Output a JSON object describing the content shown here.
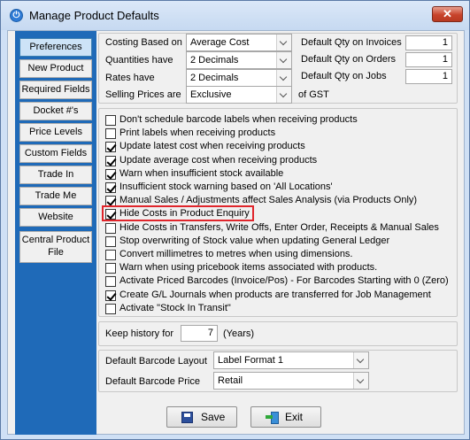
{
  "window": {
    "title": "Manage Product Defaults",
    "close_glyph": "✕"
  },
  "sidebar": {
    "items": [
      {
        "label": "Preferences"
      },
      {
        "label": "New Product"
      },
      {
        "label": "Required Fields"
      },
      {
        "label": "Docket #'s"
      },
      {
        "label": "Price Levels"
      },
      {
        "label": "Custom Fields"
      },
      {
        "label": "Trade In"
      },
      {
        "label": "Trade Me"
      },
      {
        "label": "Website"
      },
      {
        "label": "Central Product File"
      }
    ]
  },
  "settings": {
    "costing_label": "Costing Based on",
    "costing_value": "Average Cost",
    "quantities_label": "Quantities have",
    "quantities_value": "2 Decimals",
    "rates_label": "Rates have",
    "rates_value": "2 Decimals",
    "selling_label": "Selling Prices are",
    "selling_value": "Exclusive",
    "gst_suffix": "of GST",
    "qty_invoices_label": "Default Qty on Invoices",
    "qty_invoices_value": "1",
    "qty_orders_label": "Default Qty on Orders",
    "qty_orders_value": "1",
    "qty_jobs_label": "Default Qty on Jobs",
    "qty_jobs_value": "1"
  },
  "options": [
    {
      "label": "Don't schedule barcode labels when receiving products",
      "checked": false
    },
    {
      "label": "Print labels when receiving products",
      "checked": false
    },
    {
      "label": "Update latest cost when receiving products",
      "checked": true
    },
    {
      "label": "Update average cost when receiving products",
      "checked": true
    },
    {
      "label": "Warn when insufficient stock available",
      "checked": true
    },
    {
      "label": "Insufficient stock warning based on 'All Locations'",
      "checked": true
    },
    {
      "label": "Manual Sales / Adjustments affect Sales Analysis (via Products Only)",
      "checked": true
    },
    {
      "label": "Hide Costs in Product Enquiry",
      "checked": true
    },
    {
      "label": "Hide Costs in Transfers, Write Offs, Enter Order, Receipts & Manual Sales",
      "checked": false
    },
    {
      "label": "Stop overwriting of Stock value when updating General Ledger",
      "checked": false
    },
    {
      "label": "Convert millimetres to metres when using dimensions.",
      "checked": false
    },
    {
      "label": "Warn when using pricebook items associated with products.",
      "checked": false
    },
    {
      "label": "Activate Priced Barcodes (Invoice/Pos) - For Barcodes Starting with 0 (Zero)",
      "checked": false
    },
    {
      "label": "Create G/L Journals when products are transferred for Job Management",
      "checked": true
    },
    {
      "label": "Activate \"Stock In Transit\"",
      "checked": false
    }
  ],
  "history": {
    "label": "Keep history for",
    "value": "7",
    "unit": "(Years)"
  },
  "barcode": {
    "layout_label": "Default Barcode Layout",
    "layout_value": "Label Format 1",
    "price_label": "Default Barcode Price",
    "price_value": "Retail"
  },
  "buttons": {
    "save": "Save",
    "exit": "Exit"
  }
}
